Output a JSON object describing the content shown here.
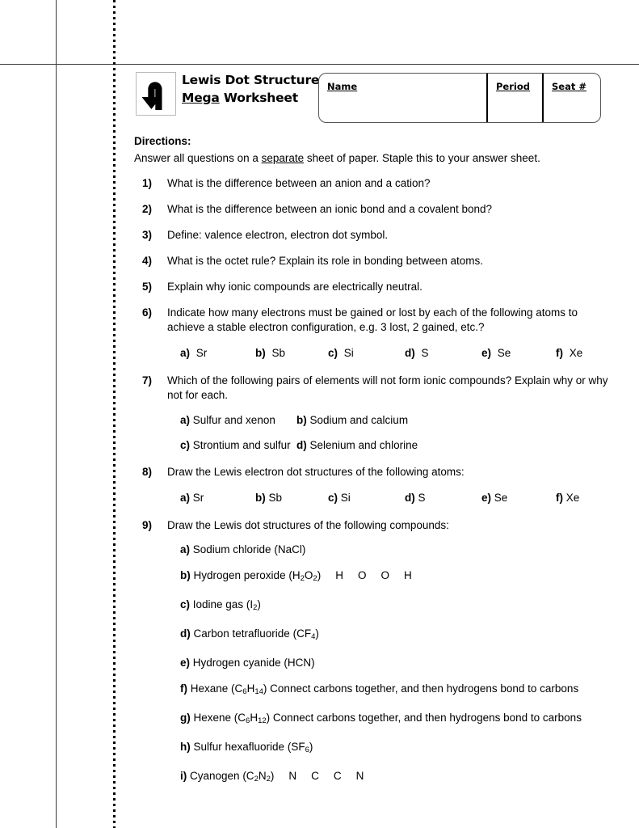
{
  "header": {
    "logo_icon": "u-turn-arrow-icon",
    "title_line1": "Lewis Dot Structure",
    "title_line2_underlined": "Mega",
    "title_line2_rest": " Worksheet",
    "namebox": {
      "name_label": "Name",
      "period_label": "Period",
      "seat_label": "Seat #"
    }
  },
  "directions": {
    "heading": "Directions:",
    "text_before": "Answer all questions on a ",
    "text_underlined": "separate",
    "text_after": " sheet of paper. Staple this to your answer sheet."
  },
  "questions": [
    {
      "num": "1)",
      "text": "What is the difference between an anion and a cation?"
    },
    {
      "num": "2)",
      "text": "What is the difference between an ionic bond and a covalent bond?"
    },
    {
      "num": "3)",
      "text": "Define: valence electron, electron dot symbol."
    },
    {
      "num": "4)",
      "text": "What is the octet rule? Explain its role in bonding between atoms."
    },
    {
      "num": "5)",
      "text": "Explain why ionic compounds are electrically neutral."
    },
    {
      "num": "6)",
      "text": "Indicate how many electrons must be gained or lost by each of the following atoms to achieve a stable electron configuration, e.g. 3 lost, 2 gained, etc.?",
      "elements": [
        {
          "label": "a)",
          "symbol": "Sr"
        },
        {
          "label": "b)",
          "symbol": "Sb"
        },
        {
          "label": "c)",
          "symbol": "Si"
        },
        {
          "label": "d)",
          "symbol": "S"
        },
        {
          "label": "e)",
          "symbol": "Se"
        },
        {
          "label": "f)",
          "symbol": "Xe"
        }
      ]
    },
    {
      "num": "7)",
      "text": "Which of the following pairs of elements will not form ionic compounds? Explain why or why not for each.",
      "pairs": [
        {
          "label": "a)",
          "text": "Sulfur and xenon"
        },
        {
          "label": "b)",
          "text": "Sodium and calcium"
        },
        {
          "label": "c)",
          "text": "Strontium and sulfur"
        },
        {
          "label": "d)",
          "text": "Selenium and chlorine"
        }
      ]
    },
    {
      "num": "8)",
      "text": "Draw the Lewis electron dot structures of the following atoms:",
      "elements": [
        {
          "label": "a)",
          "symbol": "Sr"
        },
        {
          "label": "b)",
          "symbol": "Sb"
        },
        {
          "label": "c)",
          "symbol": "Si"
        },
        {
          "label": "d)",
          "symbol": "S"
        },
        {
          "label": "e)",
          "symbol": "Se"
        },
        {
          "label": "f)",
          "symbol": "Xe"
        }
      ]
    },
    {
      "num": "9)",
      "text": "Draw the Lewis dot structures of the following compounds:",
      "compounds": [
        {
          "label": "a)",
          "name": "Sodium chloride",
          "formula": [
            {
              "t": "(NaCl)"
            }
          ],
          "atoms": []
        },
        {
          "label": "b)",
          "name": "Hydrogen peroxide",
          "formula": [
            {
              "t": "(H"
            },
            {
              "sub": "2"
            },
            {
              "t": "O"
            },
            {
              "sub": "2"
            },
            {
              "t": ")"
            }
          ],
          "atoms": [
            "H",
            "O",
            "O",
            "H"
          ]
        },
        {
          "label": "c)",
          "name": "Iodine gas",
          "formula": [
            {
              "t": "(I"
            },
            {
              "sub": "2"
            },
            {
              "t": ")"
            }
          ],
          "atoms": []
        },
        {
          "label": "d)",
          "name": "Carbon tetrafluoride",
          "formula": [
            {
              "t": "(CF"
            },
            {
              "sub": "4"
            },
            {
              "t": ")"
            }
          ],
          "atoms": []
        },
        {
          "label": "e)",
          "name": "Hydrogen cyanide",
          "formula": [
            {
              "t": "(HCN)"
            }
          ],
          "atoms": []
        },
        {
          "label": "f)",
          "name": "Hexane",
          "formula": [
            {
              "t": "(C"
            },
            {
              "sub": "6"
            },
            {
              "t": "H"
            },
            {
              "sub": "14"
            },
            {
              "t": ")"
            }
          ],
          "suffix": " Connect carbons together, and then hydrogens bond to carbons",
          "atoms": []
        },
        {
          "label": "g)",
          "name": "Hexene",
          "formula": [
            {
              "t": "(C"
            },
            {
              "sub": "6"
            },
            {
              "t": "H"
            },
            {
              "sub": "12"
            },
            {
              "t": ")"
            }
          ],
          "suffix": " Connect carbons together, and then hydrogens bond to carbons",
          "atoms": []
        },
        {
          "label": "h)",
          "name": "Sulfur hexafluoride",
          "formula": [
            {
              "t": "(SF"
            },
            {
              "sub": "6"
            },
            {
              "t": ")"
            }
          ],
          "atoms": []
        },
        {
          "label": "i)",
          "name": "Cyanogen",
          "formula": [
            {
              "t": "(C"
            },
            {
              "sub": "2"
            },
            {
              "t": "N"
            },
            {
              "sub": "2"
            },
            {
              "t": ")"
            }
          ],
          "atoms": [
            "N",
            "C",
            "C",
            "N"
          ]
        }
      ]
    }
  ],
  "layout": {
    "element_columns": [
      16,
      109,
      199,
      294,
      389,
      481
    ],
    "element_columns_q8": [
      16,
      109,
      199,
      294,
      389,
      481
    ]
  },
  "colors": {
    "ink": "#000000",
    "rule_line": "#3a3a3a",
    "box_border": "#555555",
    "logo_border": "#b9b9b9"
  }
}
